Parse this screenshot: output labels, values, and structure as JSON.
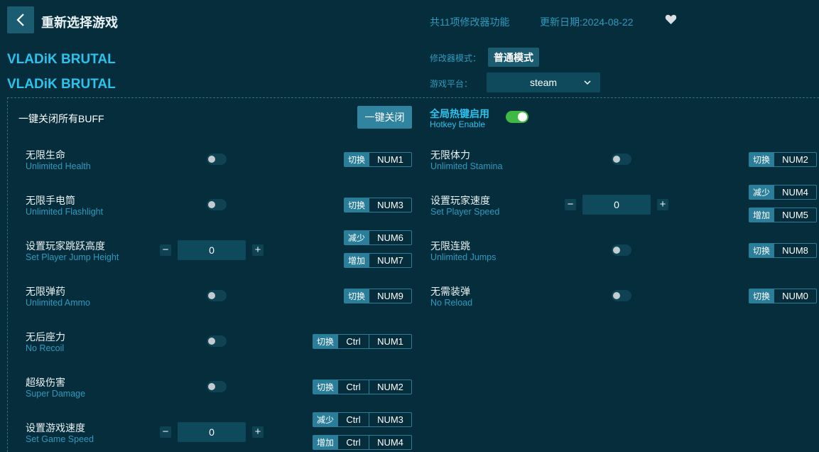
{
  "header": {
    "title": "重新选择游戏",
    "feature_count": "共11项修改器功能",
    "update_date": "更新日期:2024-08-22"
  },
  "game": {
    "title_line1": "VLADiK BRUTAL",
    "title_line2": "VLADiK BRUTAL"
  },
  "mode": {
    "label": "修改器模式：",
    "value": "普通模式"
  },
  "platform": {
    "label": "游戏平台：",
    "value": "steam"
  },
  "one_click": {
    "label": "一键关闭所有BUFF",
    "button": "一键关闭"
  },
  "hotkey_enable": {
    "label_cn": "全局热键启用",
    "label_en": "Hotkey Enable",
    "enabled": true
  },
  "features": [
    {
      "cn": "无限生命",
      "en": "Unlimited Health",
      "type": "toggle",
      "on": false,
      "hotkeys": [
        {
          "action": "切换",
          "keys": [
            "NUM1"
          ]
        }
      ]
    },
    {
      "cn": "无限体力",
      "en": "Unlimited Stamina",
      "type": "toggle",
      "on": false,
      "hotkeys": [
        {
          "action": "切换",
          "keys": [
            "NUM2"
          ]
        }
      ]
    },
    {
      "cn": "无限手电筒",
      "en": "Unlimited Flashlight",
      "type": "toggle",
      "on": false,
      "hotkeys": [
        {
          "action": "切换",
          "keys": [
            "NUM3"
          ]
        }
      ]
    },
    {
      "cn": "设置玩家速度",
      "en": "Set Player Speed",
      "type": "stepper",
      "value": "0",
      "hotkeys": [
        {
          "action": "减少",
          "keys": [
            "NUM4"
          ]
        },
        {
          "action": "增加",
          "keys": [
            "NUM5"
          ]
        }
      ]
    },
    {
      "cn": "设置玩家跳跃高度",
      "en": "Set Player Jump Height",
      "type": "stepper",
      "value": "0",
      "hotkeys": [
        {
          "action": "减少",
          "keys": [
            "NUM6"
          ]
        },
        {
          "action": "增加",
          "keys": [
            "NUM7"
          ]
        }
      ]
    },
    {
      "cn": "无限连跳",
      "en": "Unlimited Jumps",
      "type": "toggle",
      "on": false,
      "hotkeys": [
        {
          "action": "切换",
          "keys": [
            "NUM8"
          ]
        }
      ]
    },
    {
      "cn": "无限弹药",
      "en": "Unlimited Ammo",
      "type": "toggle",
      "on": false,
      "hotkeys": [
        {
          "action": "切换",
          "keys": [
            "NUM9"
          ]
        }
      ]
    },
    {
      "cn": "无需装弹",
      "en": "No Reload",
      "type": "toggle",
      "on": false,
      "hotkeys": [
        {
          "action": "切换",
          "keys": [
            "NUM0"
          ]
        }
      ]
    },
    {
      "cn": "无后座力",
      "en": "No Recoil",
      "type": "toggle",
      "on": false,
      "hotkeys": [
        {
          "action": "切换",
          "keys": [
            "Ctrl",
            "NUM1"
          ]
        }
      ]
    },
    {
      "cn": "超级伤害",
      "en": "Super Damage",
      "type": "toggle",
      "on": false,
      "hotkeys": [
        {
          "action": "切换",
          "keys": [
            "Ctrl",
            "NUM2"
          ]
        }
      ]
    },
    {
      "cn": "设置游戏速度",
      "en": "Set Game Speed",
      "type": "stepper",
      "value": "0",
      "hotkeys": [
        {
          "action": "减少",
          "keys": [
            "Ctrl",
            "NUM3"
          ]
        },
        {
          "action": "增加",
          "keys": [
            "Ctrl",
            "NUM4"
          ]
        }
      ]
    }
  ],
  "stepper": {
    "minus": "−",
    "plus": "+"
  },
  "colors": {
    "background": "#062d3b",
    "accent": "#2bc3ee",
    "button": "#1c5c70",
    "hotkey_tag": "#2a7e99",
    "toggle_on": "#3fb944"
  }
}
